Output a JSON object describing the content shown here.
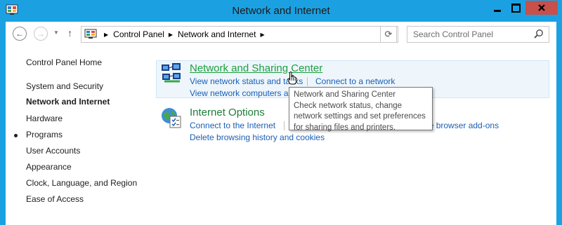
{
  "window": {
    "title": "Network and Internet",
    "accent_color": "#1ba1e2",
    "close_color": "#c7504a"
  },
  "nav": {
    "back_icon": "back-arrow-icon",
    "forward_icon": "forward-arrow-icon",
    "up_icon": "up-arrow-icon",
    "back_glyph": "←",
    "forward_glyph": "→",
    "up_glyph": "↑",
    "dropdown_glyph": "▼",
    "refresh_glyph": "⟳"
  },
  "address": {
    "crumbs": [
      "Control Panel",
      "Network and Internet"
    ]
  },
  "search": {
    "placeholder": "Search Control Panel"
  },
  "sidebar": {
    "items": [
      {
        "label": "Control Panel Home",
        "current": false
      },
      {
        "label": "System and Security",
        "current": false
      },
      {
        "label": "Network and Internet",
        "current": true
      },
      {
        "label": "Hardware",
        "current": false
      },
      {
        "label": "Programs",
        "current": false
      },
      {
        "label": "User Accounts",
        "current": false
      },
      {
        "label": "Appearance",
        "current": false
      },
      {
        "label": "Clock, Language, and Region",
        "current": false
      },
      {
        "label": "Ease of Access",
        "current": false
      }
    ]
  },
  "categories": {
    "network_sharing": {
      "title": "Network and Sharing Center",
      "icon": "network-sharing-icon",
      "task_view_status": "View network status and tasks",
      "task_connect": "Connect to a network",
      "task_view_computers": "View network computers and devices"
    },
    "internet_options": {
      "title": "Internet Options",
      "icon": "internet-options-icon",
      "task_connect_internet": "Connect to the Internet",
      "task_addons": "Manage browser add-ons",
      "task_delete_history": "Delete browsing history and cookies"
    }
  },
  "tooltip": {
    "title": "Network and Sharing Center",
    "line1": "Check network status, change",
    "line2": "network settings and set preferences",
    "line3": "for sharing files and printers."
  }
}
